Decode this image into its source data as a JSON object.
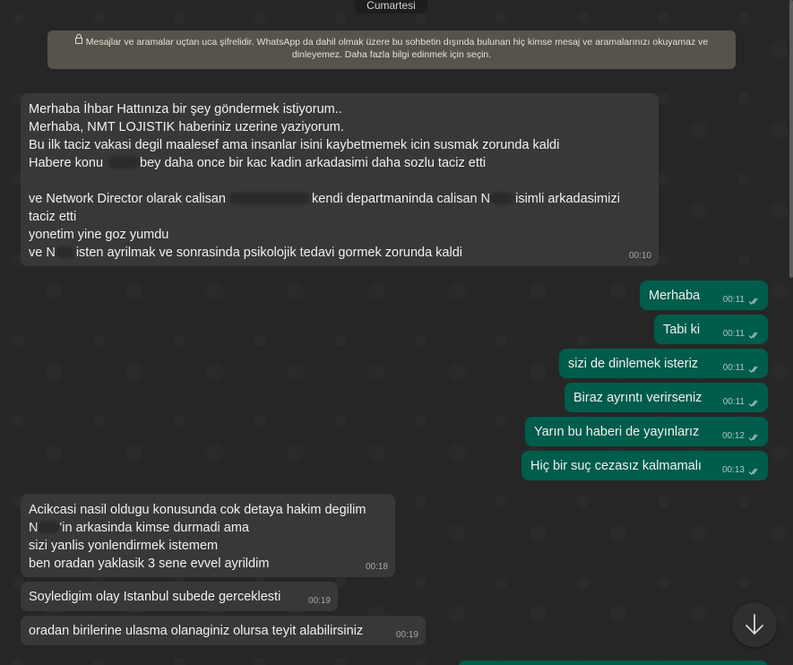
{
  "date_chip": "Cumartesi",
  "encryption_notice": "Mesajlar ve aramalar uçtan uca şifrelidir. WhatsApp da dahil olmak üzere bu sohbetin dışında bulunan hiç kimse mesaj ve aramalarınızı okuyamaz ve dinleyemez. Daha fazla bilgi edinmek için seçin.",
  "messages": {
    "m1": {
      "lines": [
        "Merhaba İhbar Hattınıza bir şey göndermek istiyorum..",
        "Merhaba, NMT LOJISTIK haberiniz uzerine yaziyorum.",
        "Bu ilk taciz vakasi degil maalesef ama insanlar isini kaybetmemek icin susmak zorunda kaldi",
        "Habere konu",
        "bey daha once bir kac kadin arkadasimi daha sozlu taciz etti",
        "ve Network Director olarak calisan",
        "kendi departmaninda calisan N",
        "isimli arkadasimizi",
        "taciz etti",
        "yonetim yine goz yumdu",
        "ve N",
        "isten ayrilmak ve sonrasinda psikolojik tedavi gormek zorunda kaldi"
      ],
      "time": "00:10"
    },
    "m2": {
      "text": "Merhaba",
      "time": "00:11"
    },
    "m3": {
      "text": "Tabi ki",
      "time": "00:11"
    },
    "m4": {
      "text": "sizi de dinlemek isteriz",
      "time": "00:11"
    },
    "m5": {
      "text": "Biraz ayrıntı verirseniz",
      "time": "00:11"
    },
    "m6": {
      "text": "Yarın bu haberi de yayınlarız",
      "time": "00:12"
    },
    "m7": {
      "text": "Hiç bir suç cezasız kalmamalı",
      "time": "00:13"
    },
    "m8": {
      "lines": [
        "Acikcasi nasil oldugu konusunda cok detaya hakim degilim",
        "N",
        "'in arkasinda kimse durmadi ama",
        "sizi yanlis yonlendirmek istemem",
        "ben oradan yaklasik 3 sene evvel ayrildim"
      ],
      "time": "00:18"
    },
    "m9": {
      "text": "Soyledigim olay Istanbul subede gerceklesti",
      "time": "00:19"
    },
    "m10": {
      "text": "oradan birilerine ulasma olanaginiz olursa teyit alabilirsiniz",
      "time": "00:19"
    }
  },
  "icons": {
    "scroll_down": "arrow-down-icon",
    "read_receipt": "double-check-icon",
    "lock": "lock-icon"
  },
  "colors": {
    "incoming_bubble": "#383838",
    "outgoing_bubble": "#005c4b",
    "read_ticks": "#a9c9c1"
  }
}
